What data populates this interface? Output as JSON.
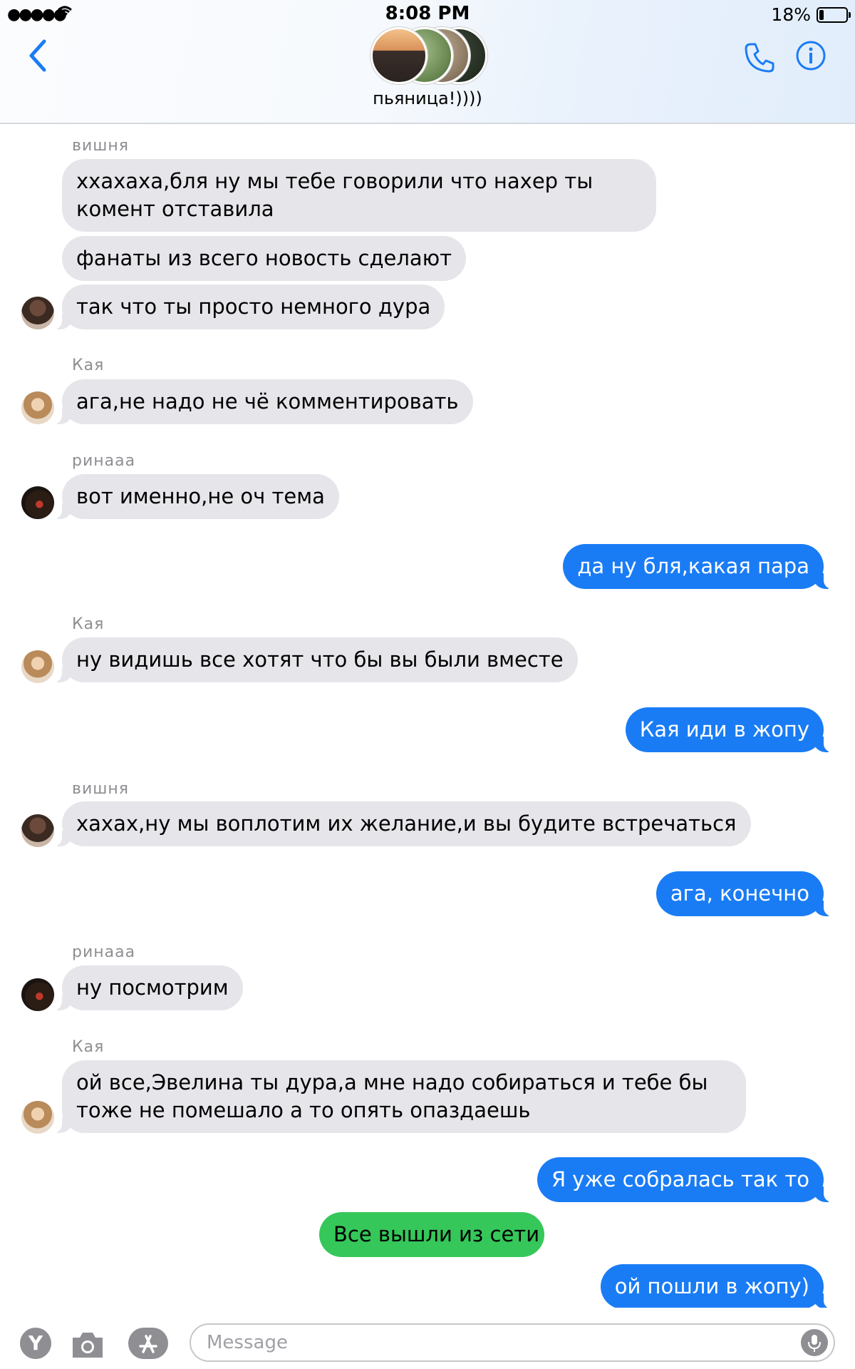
{
  "status_bar": {
    "signal": "●●●●●",
    "time": "8:08 PM",
    "battery_percent": "18%",
    "battery_level": 0.18
  },
  "header": {
    "group_name": "пьяница!))))",
    "icons": [
      "back-chevron-icon",
      "phone-icon",
      "info-icon"
    ]
  },
  "messages": [
    {
      "sender": "вишня",
      "text": "ххахаха,бля ну мы тебе говорили что нахер ты комент отставила"
    },
    {
      "text": "фанаты из всего новость сделают"
    },
    {
      "text": "так что ты просто немного дура"
    },
    {
      "sender": "Кая",
      "text": "ага,не надо не чё комментировать"
    },
    {
      "sender": "ринааа",
      "text": "вот именно,не оч тема"
    },
    {
      "text": "да ну бля,какая пара"
    },
    {
      "sender": "Кая",
      "text": "ну видишь все хотят что бы вы были вместе"
    },
    {
      "text": "Кая иди в жопу"
    },
    {
      "sender": "вишня",
      "text": "хахах,ну мы воплотим их желание,и вы будите встречаться"
    },
    {
      "text": "ага, конечно"
    },
    {
      "sender": "ринааа",
      "text": "ну посмотрим"
    },
    {
      "sender": "Кая",
      "text": "ой все,Эвелина ты дура,а мне надо собираться и тебе бы тоже не помешало а то опять опаздаешь"
    },
    {
      "text": "Я уже собралась так то"
    },
    {
      "text": "Все вышли из сети"
    },
    {
      "text": "ой пошли в жопу)"
    }
  ],
  "colors": {
    "outgoing_bubble": "#1a7cf5",
    "incoming_bubble": "#e5e5ea",
    "system_bubble": "#35c759",
    "accent": "#1a7cf5"
  },
  "composer": {
    "placeholder": "Message",
    "value": "",
    "y_button_label": "Y",
    "icons": [
      "camera-icon",
      "app-store-icon",
      "microphone-icon"
    ]
  }
}
